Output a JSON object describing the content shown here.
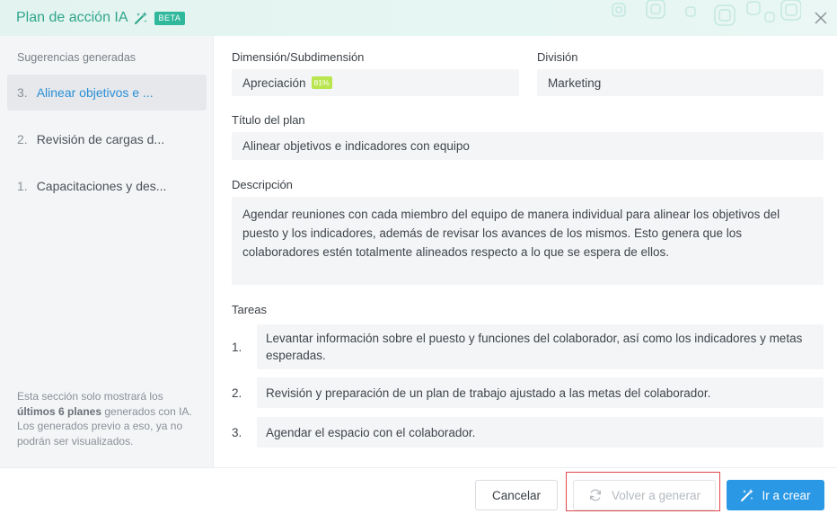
{
  "header": {
    "title": "Plan de acción IA",
    "badge": "BETA",
    "wand_icon": "magic-wand-icon",
    "close_icon": "close-icon",
    "colors": {
      "title": "#2fa58c",
      "badge_bg": "#2fb89c",
      "band": "#e3f4f0"
    }
  },
  "sidebar": {
    "heading": "Sugerencias generadas",
    "items": [
      {
        "num": "3.",
        "label": "Alinear objetivos e ...",
        "active": true
      },
      {
        "num": "2.",
        "label": "Revisión de cargas d...",
        "active": false
      },
      {
        "num": "1.",
        "label": "Capacitaciones y des...",
        "active": false
      }
    ],
    "note": {
      "before": "Esta sección solo mostrará los ",
      "bold": "últimos 6 planes",
      "after": " generados con IA. Los generados previo a eso, ya no podrán ser visualizados."
    }
  },
  "form": {
    "dimension_label": "Dimensión/Subdimensión",
    "dimension_value": "Apreciación",
    "dimension_score": "81%",
    "division_label": "División",
    "division_value": "Marketing",
    "title_label": "Título del plan",
    "title_value": "Alinear objetivos e indicadores con equipo",
    "description_label": "Descripción",
    "description_value": "Agendar reuniones con cada miembro del equipo de manera individual para alinear los objetivos del puesto y los indicadores, además de revisar los avances de los mismos. Esto genera que los colaboradores estén totalmente alineados respecto a lo que se espera de ellos.",
    "tasks_label": "Tareas",
    "tasks": [
      {
        "num": "1.",
        "text": "Levantar información sobre el puesto y funciones del colaborador, así como los indicadores y metas esperadas."
      },
      {
        "num": "2.",
        "text": "Revisión y preparación de un plan de trabajo ajustado a las metas del colaborador."
      },
      {
        "num": "3.",
        "text": "Agendar el espacio con el colaborador."
      }
    ]
  },
  "footer": {
    "cancel_label": "Cancelar",
    "regenerate_label": "Volver a generar",
    "regenerate_icon": "refresh-icon",
    "create_label": "Ir a crear",
    "create_icon": "magic-wand-icon",
    "colors": {
      "primary": "#2a98e4",
      "highlight": "#e0484c",
      "active_link": "#2b8fd6"
    }
  }
}
